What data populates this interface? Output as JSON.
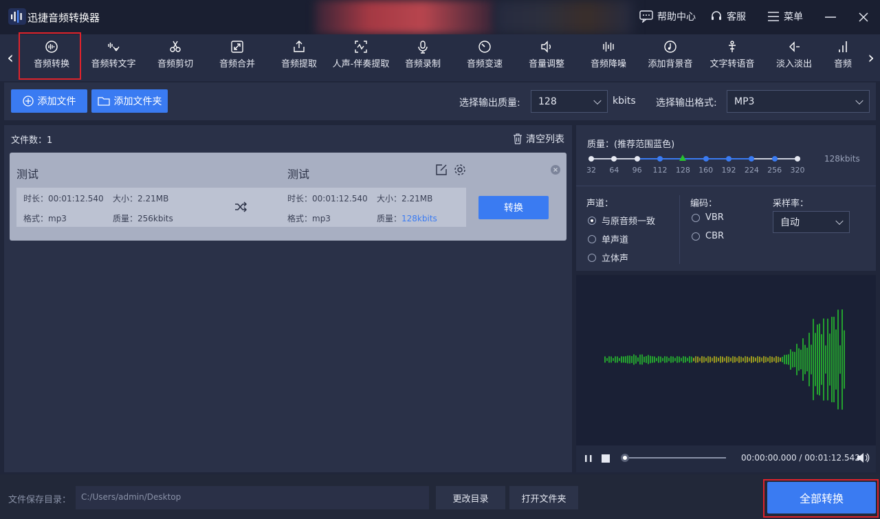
{
  "app": {
    "title": "迅捷音频转换器"
  },
  "titlebar": {
    "help": "帮助中心",
    "service": "客服",
    "menu": "菜单"
  },
  "tools": [
    {
      "label": "音频转换",
      "icon": "audio-convert-icon"
    },
    {
      "label": "音频转文字",
      "icon": "audio-to-text-icon"
    },
    {
      "label": "音频剪切",
      "icon": "scissors-icon"
    },
    {
      "label": "音频合并",
      "icon": "merge-icon"
    },
    {
      "label": "音频提取",
      "icon": "extract-icon"
    },
    {
      "label": "人声-伴奏提取",
      "icon": "vocal-extract-icon"
    },
    {
      "label": "音频录制",
      "icon": "microphone-icon"
    },
    {
      "label": "音频变速",
      "icon": "speed-icon"
    },
    {
      "label": "音量调整",
      "icon": "volume-icon"
    },
    {
      "label": "音频降噪",
      "icon": "denoise-icon"
    },
    {
      "label": "添加背景音",
      "icon": "music-note-icon"
    },
    {
      "label": "文字转语音",
      "icon": "text-to-speech-icon"
    },
    {
      "label": "淡入淡出",
      "icon": "fade-icon"
    },
    {
      "label": "音频",
      "icon": "equalizer-icon"
    }
  ],
  "actions": {
    "add_file": "添加文件",
    "add_folder": "添加文件夹",
    "quality_label": "选择输出质量:",
    "quality_value": "128",
    "quality_unit": "kbits",
    "format_label": "选择输出格式:",
    "format_value": "MP3"
  },
  "filelist": {
    "count_label": "文件数：",
    "count": "1",
    "clear": "清空列表"
  },
  "file": {
    "src_name": "测试",
    "dst_name": "测试",
    "src_duration": "时长：00:01:12.540",
    "src_size": "大小：2.21MB",
    "src_format": "格式：mp3",
    "src_quality": "质量：256kbits",
    "dst_duration": "时长：00:01:12.540",
    "dst_size": "大小：2.21MB",
    "dst_format": "格式：mp3",
    "dst_quality_label": "质量：",
    "dst_quality_value": "128kbits",
    "convert": "转换"
  },
  "quality": {
    "title": "质量：(推荐范围蓝色)",
    "ticks": [
      "32",
      "64",
      "96",
      "112",
      "128",
      "160",
      "192",
      "224",
      "256",
      "320"
    ],
    "selected": "128",
    "value_text": "128kbits"
  },
  "channel": {
    "label": "声道：",
    "options": [
      "与原音频一致",
      "单声道",
      "立体声"
    ],
    "selected": 0
  },
  "encoding": {
    "label": "编码：",
    "options": [
      "VBR",
      "CBR"
    ]
  },
  "samplerate": {
    "label": "采样率：",
    "value": "自动"
  },
  "player": {
    "time": "00:00:00.000 / 00:01:12.542",
    "progress": 0
  },
  "bottom": {
    "save_label": "文件保存目录：",
    "save_path": "C:/Users/admin/Desktop",
    "change_dir": "更改目录",
    "open_folder": "打开文件夹",
    "convert_all": "全部转换"
  },
  "colors": {
    "accent": "#3a7bf2",
    "highlight": "#e0232b",
    "wave_green": "#27c22e",
    "wave_yellow": "#c9b21c"
  }
}
